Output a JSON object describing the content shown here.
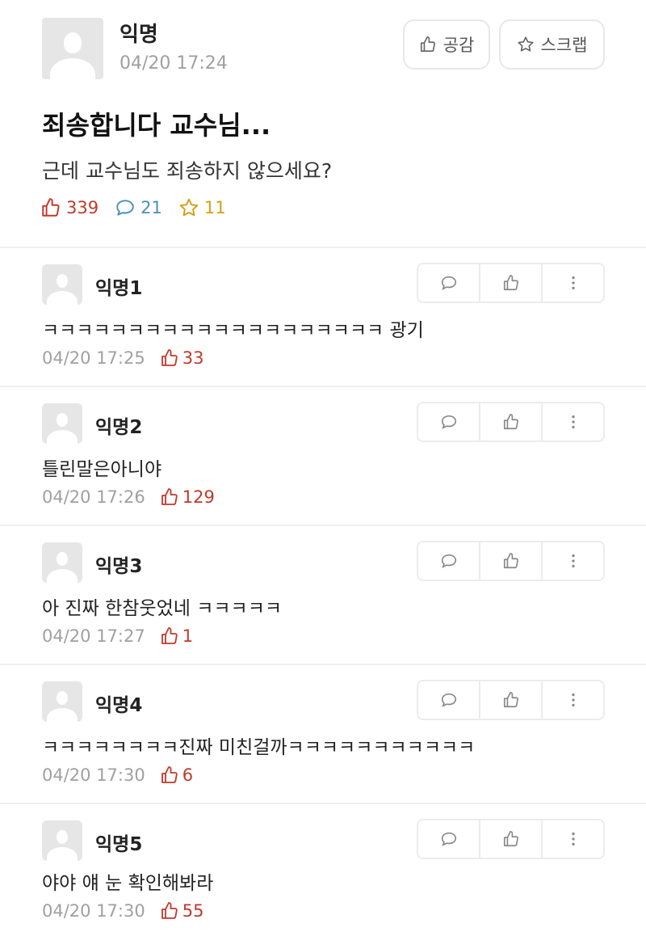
{
  "post": {
    "author": "익명",
    "time": "04/20 17:24",
    "like_button_label": "공감",
    "scrap_button_label": "스크랩",
    "title": "죄송합니다 교수님...",
    "body": "근데 교수님도 죄송하지 않으세요?",
    "stats": {
      "likes": "339",
      "comments": "21",
      "scraps": "11"
    }
  },
  "comments": [
    {
      "author": "익명1",
      "text": "ㅋㅋㅋㅋㅋㅋㅋㅋㅋㅋㅋㅋㅋㅋㅋㅋㅋㅋㅋㅋ 광기",
      "time": "04/20 17:25",
      "likes": "33"
    },
    {
      "author": "익명2",
      "text": "틀린말은아니야",
      "time": "04/20 17:26",
      "likes": "129"
    },
    {
      "author": "익명3",
      "text": "아 진짜 한참웃었네 ㅋㅋㅋㅋㅋ",
      "time": "04/20 17:27",
      "likes": "1"
    },
    {
      "author": "익명4",
      "text": "ㅋㅋㅋㅋㅋㅋㅋㅋ진짜 미친걸까ㅋㅋㅋㅋㅋㅋㅋㅋㅋㅋㅋ",
      "time": "04/20 17:30",
      "likes": "6"
    },
    {
      "author": "익명5",
      "text": "야야 얘 눈 확인해봐라",
      "time": "04/20 17:30",
      "likes": "55"
    }
  ],
  "colors": {
    "like": "#c0392b",
    "comment": "#4a90b8",
    "scrap": "#d4a017",
    "muted": "#a0a0a0"
  },
  "icons": {
    "like": "thumbs-up-icon",
    "comment": "speech-bubble-icon",
    "scrap": "star-icon",
    "more": "vertical-dots-icon"
  }
}
